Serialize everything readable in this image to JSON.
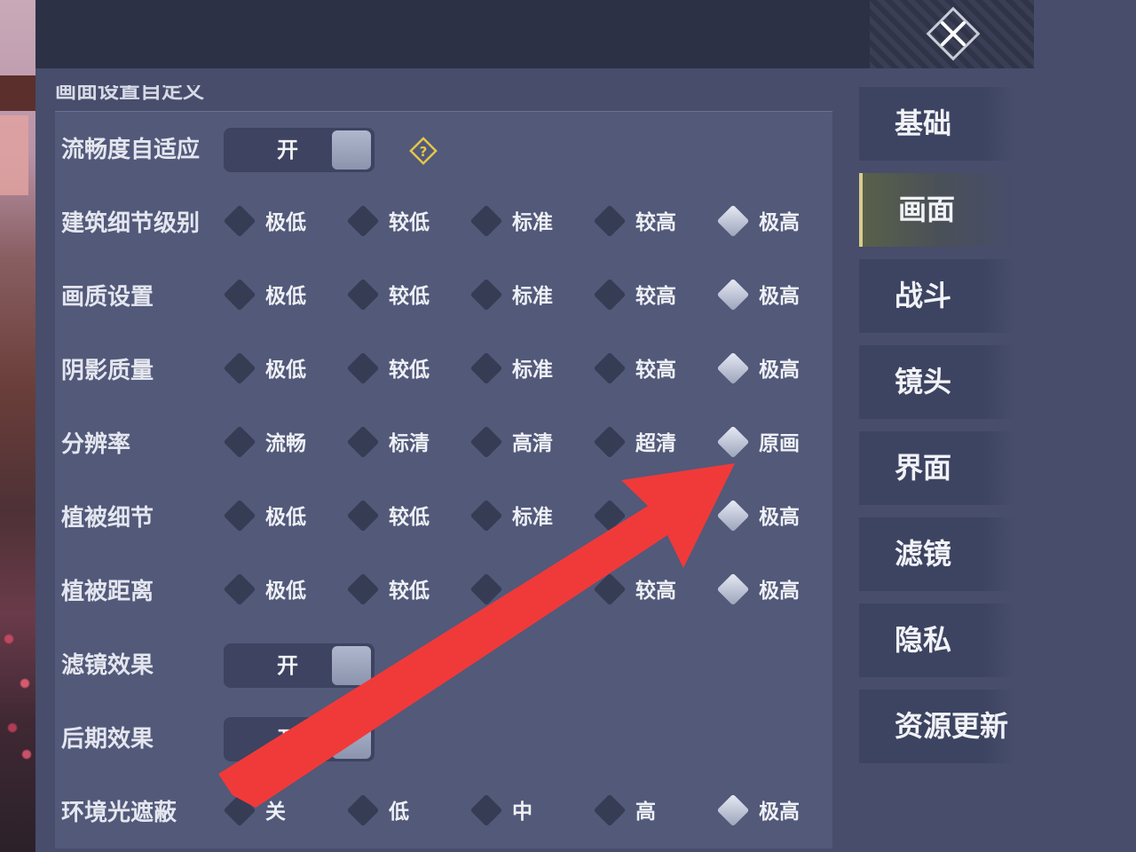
{
  "section_title": "画面设置自定义",
  "rows": [
    {
      "label": "流畅度自适应",
      "type": "toggle",
      "value": "开",
      "help": true
    },
    {
      "label": "建筑细节级别",
      "type": "options",
      "options": [
        "极低",
        "较低",
        "标准",
        "较高",
        "极高"
      ],
      "selected": 4
    },
    {
      "label": "画质设置",
      "type": "options",
      "options": [
        "极低",
        "较低",
        "标准",
        "较高",
        "极高"
      ],
      "selected": 4
    },
    {
      "label": "阴影质量",
      "type": "options",
      "options": [
        "极低",
        "较低",
        "标准",
        "较高",
        "极高"
      ],
      "selected": 4
    },
    {
      "label": "分辨率",
      "type": "options",
      "options": [
        "流畅",
        "标清",
        "高清",
        "超清",
        "原画"
      ],
      "selected": 4
    },
    {
      "label": "植被细节",
      "type": "options",
      "options": [
        "极低",
        "较低",
        "标准",
        "",
        "极高"
      ],
      "selected": 4
    },
    {
      "label": "植被距离",
      "type": "options",
      "options": [
        "极低",
        "较低",
        "",
        "较高",
        "极高"
      ],
      "selected": 4
    },
    {
      "label": "滤镜效果",
      "type": "toggle",
      "value": "开"
    },
    {
      "label": "后期效果",
      "type": "toggle",
      "value": "开"
    },
    {
      "label": "环境光遮蔽",
      "type": "options",
      "options": [
        "关",
        "低",
        "中",
        "高",
        "极高"
      ],
      "selected": 4
    }
  ],
  "nav": {
    "items": [
      "基础",
      "画面",
      "战斗",
      "镜头",
      "界面",
      "滤镜",
      "隐私",
      "资源更新"
    ],
    "active": 1
  },
  "colors": {
    "annotation_arrow": "#f03a3a",
    "active_tab_accent": "#d9cc8c",
    "help_icon": "#e3c64a"
  },
  "icons": {
    "close": "close-x-icon",
    "help": "question-diamond-icon"
  }
}
